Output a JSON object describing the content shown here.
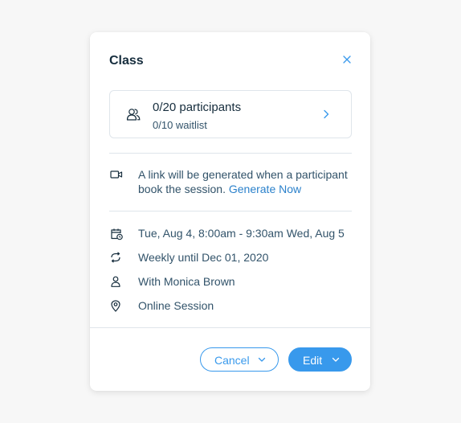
{
  "dialog": {
    "title": "Class",
    "close_icon": "close-icon",
    "participants": {
      "count_label": "0/20 participants",
      "waitlist_label": "0/10 waitlist",
      "icon": "people-icon"
    },
    "video": {
      "icon": "video-camera-icon",
      "message_line1": "A link will be generated when a participant",
      "message_line2": "book the session.",
      "link_label": "Generate Now"
    },
    "details": {
      "datetime": "Tue, Aug 4, 8:00am - 9:30am Wed, Aug 5",
      "recurrence": "Weekly until Dec 01, 2020",
      "staff": "With Monica Brown",
      "location": "Online Session"
    },
    "footer": {
      "cancel_label": "Cancel",
      "edit_label": "Edit"
    }
  },
  "colors": {
    "accent": "#3899ec",
    "link": "#2b81cb",
    "text_dark": "#162d3d",
    "text_secondary": "#32536a",
    "border": "#dfe5eb",
    "background": "#f7f7f7"
  }
}
